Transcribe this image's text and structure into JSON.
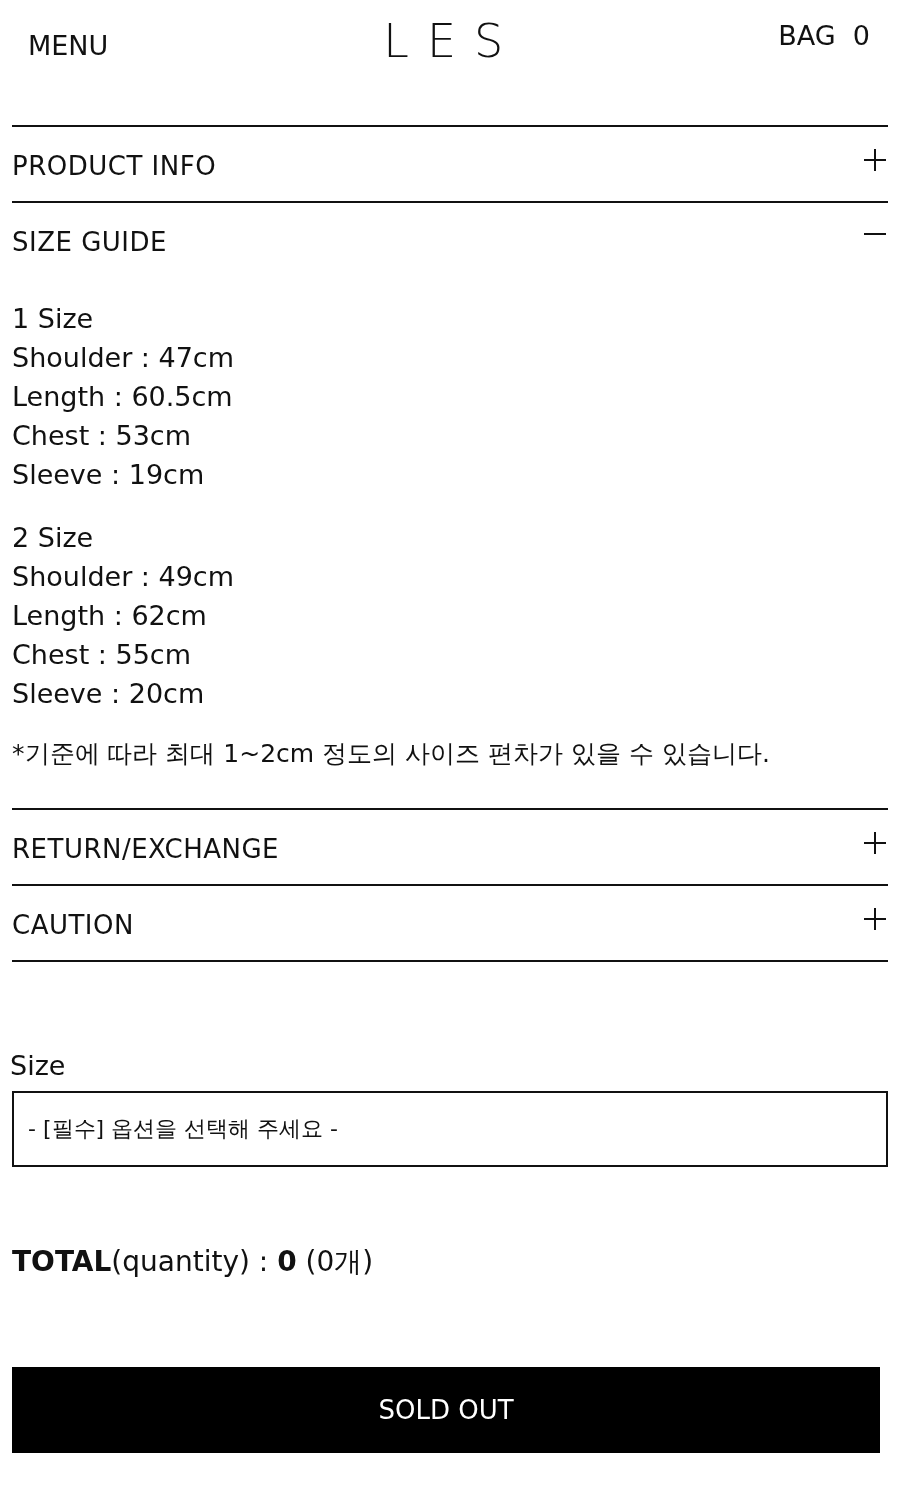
{
  "header": {
    "menu": "MENU",
    "logo": "LES",
    "bag": "BAG  0"
  },
  "sections": [
    {
      "title": "PRODUCT INFO",
      "expanded": false
    },
    {
      "title": "SIZE GUIDE",
      "expanded": true,
      "blocks": [
        [
          "1 Size",
          "Shoulder : 47cm",
          "Length : 60.5cm",
          "Chest : 53cm",
          "Sleeve : 19cm"
        ],
        [
          "2 Size",
          "Shoulder : 49cm",
          "Length : 62cm",
          "Chest : 55cm",
          "Sleeve : 20cm"
        ]
      ],
      "note": "*기준에 따라 최대 1~2cm 정도의 사이즈 편차가 있을 수 있습니다."
    },
    {
      "title": "RETURN/EXCHANGE",
      "expanded": false
    },
    {
      "title": "CAUTION",
      "expanded": false
    }
  ],
  "option": {
    "label": "Size",
    "value": "- [필수] 옵션을 선택해 주세요 -"
  },
  "total": "**TOTAL**(quantity) : **0** (0개)",
  "button": "SOLD OUT"
}
